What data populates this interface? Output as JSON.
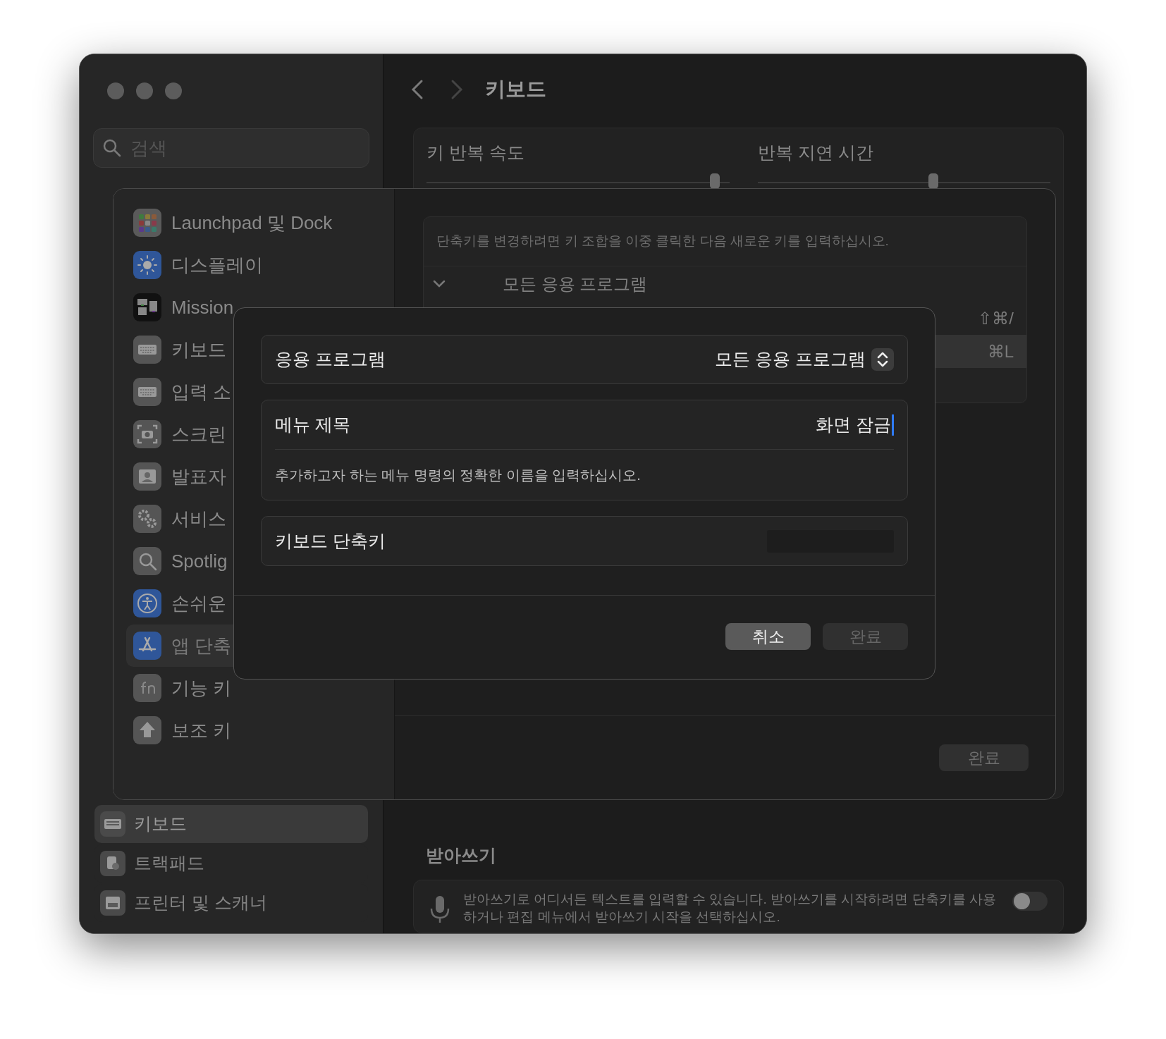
{
  "sidebar": {
    "search": {
      "placeholder": "검색"
    },
    "items": [
      {
        "label": "키보드",
        "selected": true
      },
      {
        "label": "트랙패드",
        "selected": false
      },
      {
        "label": "프린터 및 스캐너",
        "selected": false
      }
    ]
  },
  "header": {
    "title": "키보드"
  },
  "key_repeat": {
    "sliders": [
      {
        "label": "키 반복 속도",
        "level": 0.95
      },
      {
        "label": "반복 지연 시간",
        "level": 0.6
      }
    ]
  },
  "dictation": {
    "title": "받아쓰기",
    "description": "받아쓰기로 어디서든 텍스트를 입력할 수 있습니다. 받아쓰기를 시작하려면 단축키를 사용하거나 편집 메뉴에서 받아쓰기 시작을 선택하십시오.",
    "on": false
  },
  "shortcuts_sheet": {
    "categories": [
      {
        "label": "Launchpad 및 Dock",
        "selected": false
      },
      {
        "label": "디스플레이",
        "selected": false
      },
      {
        "label": "Mission",
        "selected": false
      },
      {
        "label": "키보드",
        "selected": false
      },
      {
        "label": "입력 소",
        "selected": false
      },
      {
        "label": "스크린",
        "selected": false
      },
      {
        "label": "발표자",
        "selected": false
      },
      {
        "label": "서비스",
        "selected": false
      },
      {
        "label": "Spotlig",
        "selected": false
      },
      {
        "label": "손쉬운",
        "selected": false
      },
      {
        "label": "앱 단축",
        "selected": true
      },
      {
        "label": "기능 키",
        "selected": false
      },
      {
        "label": "보조 키",
        "selected": false
      }
    ],
    "hint": "단축키를 변경하려면 키 조합을 이중 클릭한 다음 새로운 키를 입력하십시오.",
    "group": {
      "label": "모든 응용 프로그램",
      "expanded": true
    },
    "shortcuts": [
      {
        "keys": "⇧⌘/",
        "selected": false
      },
      {
        "keys": "⌘L",
        "selected": true
      }
    ],
    "done_button": "완료"
  },
  "add_dialog": {
    "application": {
      "label": "응용 프로그램",
      "value": "모든 응용 프로그램"
    },
    "menu_title": {
      "label": "메뉴 제목",
      "value": "화면 잠금",
      "hint": "추가하고자 하는 메뉴 명령의 정확한 이름을 입력하십시오."
    },
    "shortcut": {
      "label": "키보드 단축키"
    },
    "buttons": [
      {
        "label": "취소",
        "disabled": false
      },
      {
        "label": "완료",
        "disabled": true
      }
    ]
  }
}
